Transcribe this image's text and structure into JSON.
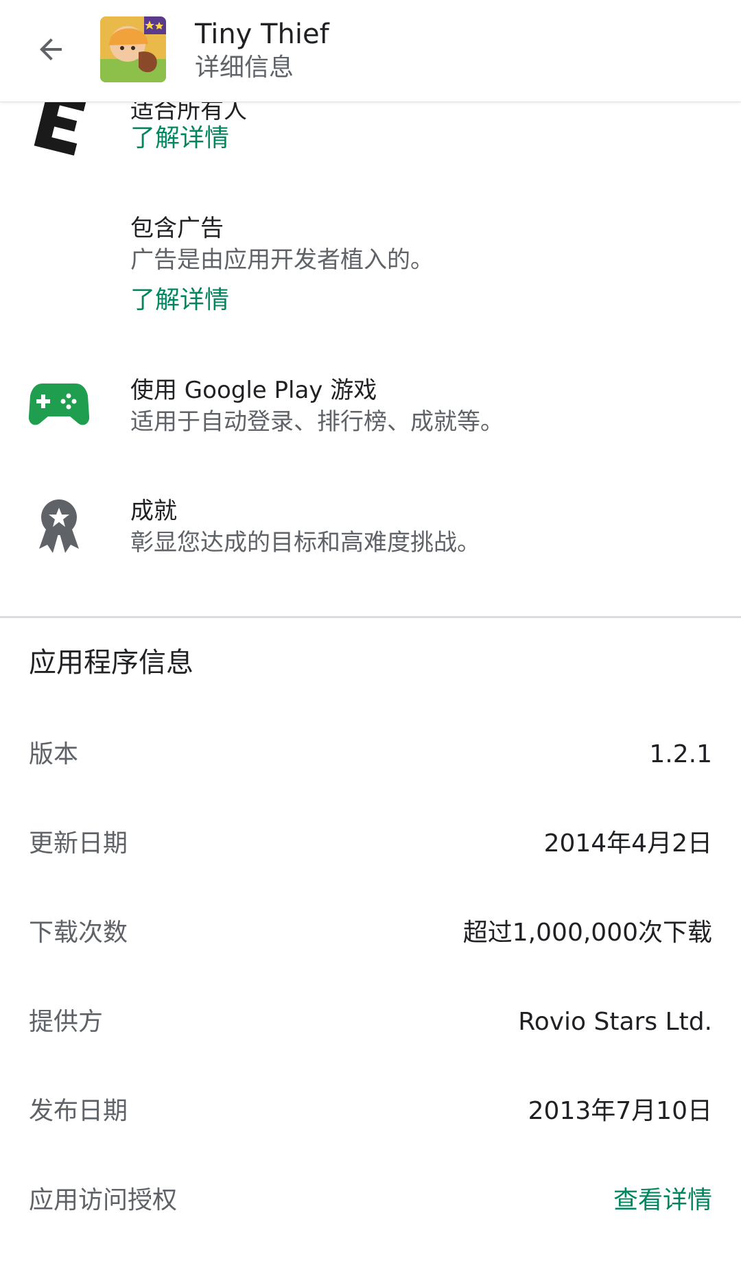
{
  "header": {
    "app_title": "Tiny Thief",
    "subtitle": "详细信息",
    "back_icon": "arrow-back-icon",
    "app_icon": "tiny-thief-app-icon"
  },
  "rating": {
    "icon": "esrb-e-icon",
    "text": "适合所有人",
    "link": "了解详情"
  },
  "ads": {
    "title": "包含广告",
    "description": "广告是由应用开发者植入的。",
    "link": "了解详情"
  },
  "play_games": {
    "icon": "gamepad-icon",
    "title": "使用 Google Play 游戏",
    "description": "适用于自动登录、排行榜、成就等。"
  },
  "achievements": {
    "icon": "award-badge-icon",
    "title": "成就",
    "description": "彰显您达成的目标和高难度挑战。"
  },
  "app_info": {
    "section_title": "应用程序信息",
    "rows": [
      {
        "label": "版本",
        "value": "1.2.1"
      },
      {
        "label": "更新日期",
        "value": "2014年4月2日"
      },
      {
        "label": "下载次数",
        "value": "超过1,000,000次下载"
      },
      {
        "label": "提供方",
        "value": "Rovio Stars Ltd."
      },
      {
        "label": "发布日期",
        "value": "2013年7月10日"
      },
      {
        "label": "应用访问授权",
        "value": "查看详情"
      }
    ]
  },
  "colors": {
    "accent_green": "#01875f",
    "primary_text": "#202124",
    "secondary_text": "#5f6368",
    "divider": "#dadce0",
    "gamepad_green": "#1e9e4e"
  }
}
